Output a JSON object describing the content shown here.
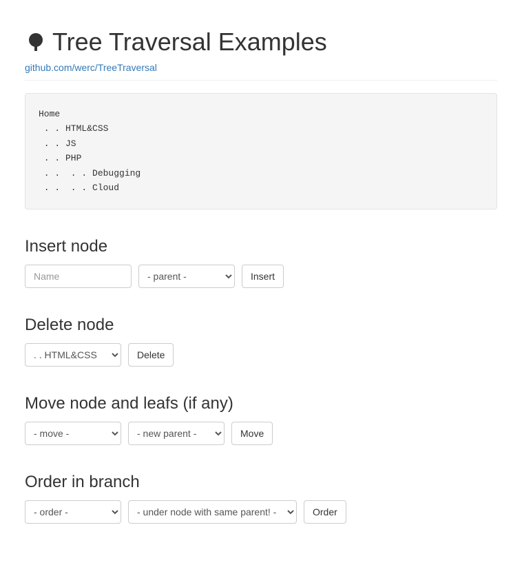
{
  "header": {
    "title": "Tree Traversal Examples",
    "link": "github.com/werc/TreeTraversal"
  },
  "tree": {
    "lines": [
      "Home",
      " . . HTML&CSS",
      " . . JS",
      " . . PHP",
      " . .  . . Debugging",
      " . .  . . Cloud"
    ]
  },
  "insert": {
    "heading": "Insert node",
    "name_placeholder": "Name",
    "parent_selected": "- parent -",
    "button": "Insert"
  },
  "delete": {
    "heading": "Delete node",
    "selected": " . . HTML&CSS",
    "button": "Delete"
  },
  "move": {
    "heading": "Move node and leafs (if any)",
    "move_selected": "- move -",
    "newparent_selected": "- new parent -",
    "button": "Move"
  },
  "order": {
    "heading": "Order in branch",
    "order_selected": "- order -",
    "under_selected": "- under node with same parent! -",
    "button": "Order"
  }
}
